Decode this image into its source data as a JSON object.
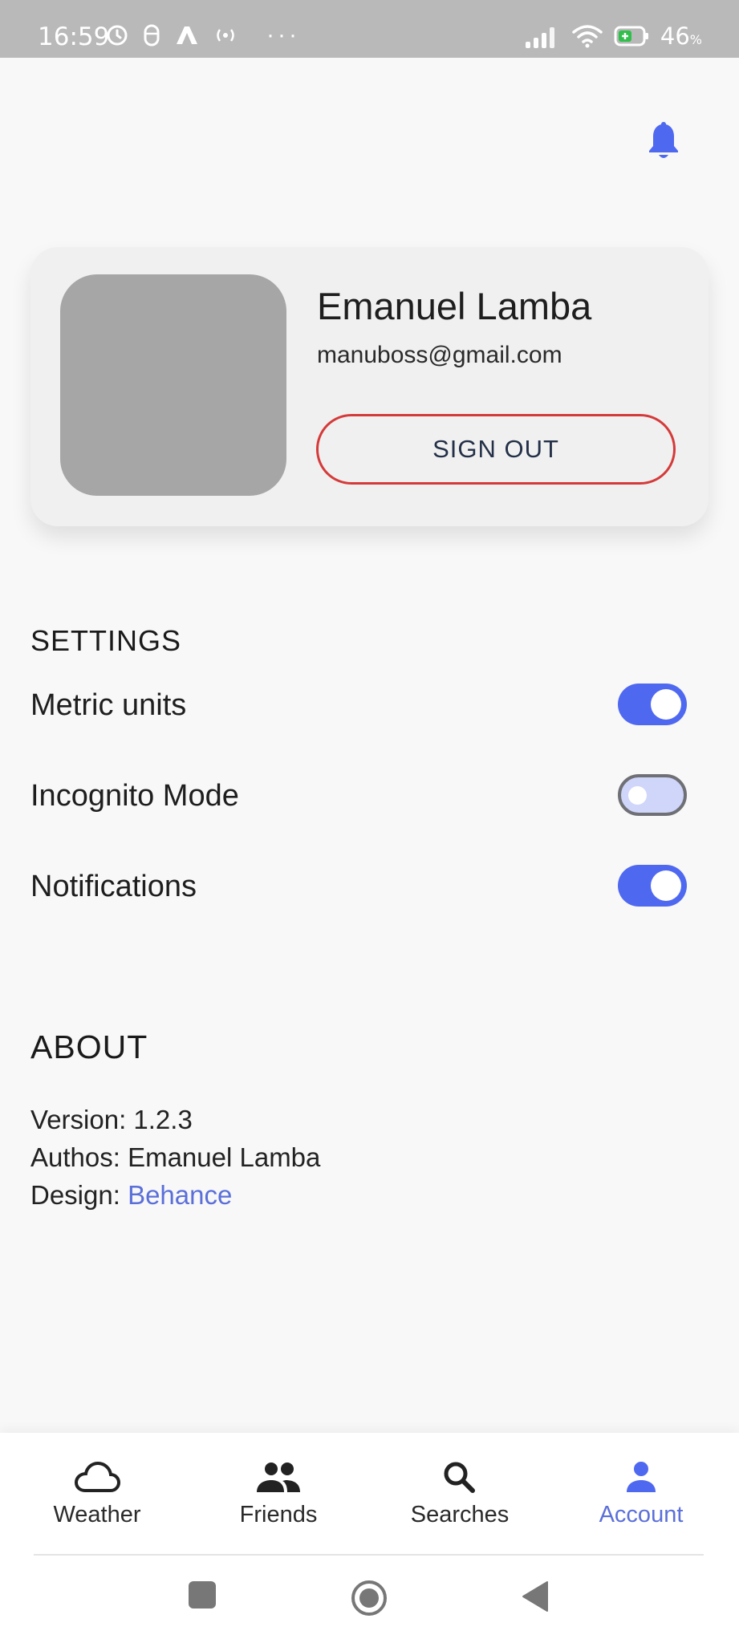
{
  "status_bar": {
    "time": "16:59",
    "battery": "46",
    "battery_unit": "%"
  },
  "profile": {
    "name": "Emanuel Lamba",
    "email": "manuboss@gmail.com",
    "sign_out_label": "SIGN OUT"
  },
  "settings": {
    "title": "SETTINGS",
    "items": [
      {
        "label": "Metric units",
        "enabled": true
      },
      {
        "label": "Incognito Mode",
        "enabled": false
      },
      {
        "label": "Notifications",
        "enabled": true
      }
    ]
  },
  "about": {
    "title": "ABOUT",
    "version": "Version: 1.2.3",
    "authors": "Authos: Emanuel Lamba",
    "design_prefix": "Design: ",
    "design_link": "Behance"
  },
  "bottom_nav": {
    "items": [
      {
        "label": "Weather",
        "icon": "cloud-icon"
      },
      {
        "label": "Friends",
        "icon": "people-icon"
      },
      {
        "label": "Searches",
        "icon": "search-icon"
      },
      {
        "label": "Account",
        "icon": "person-icon",
        "active": true
      }
    ]
  },
  "colors": {
    "accent": "#4f68f0",
    "danger": "#d53a3a",
    "link": "#5b6fd9"
  }
}
